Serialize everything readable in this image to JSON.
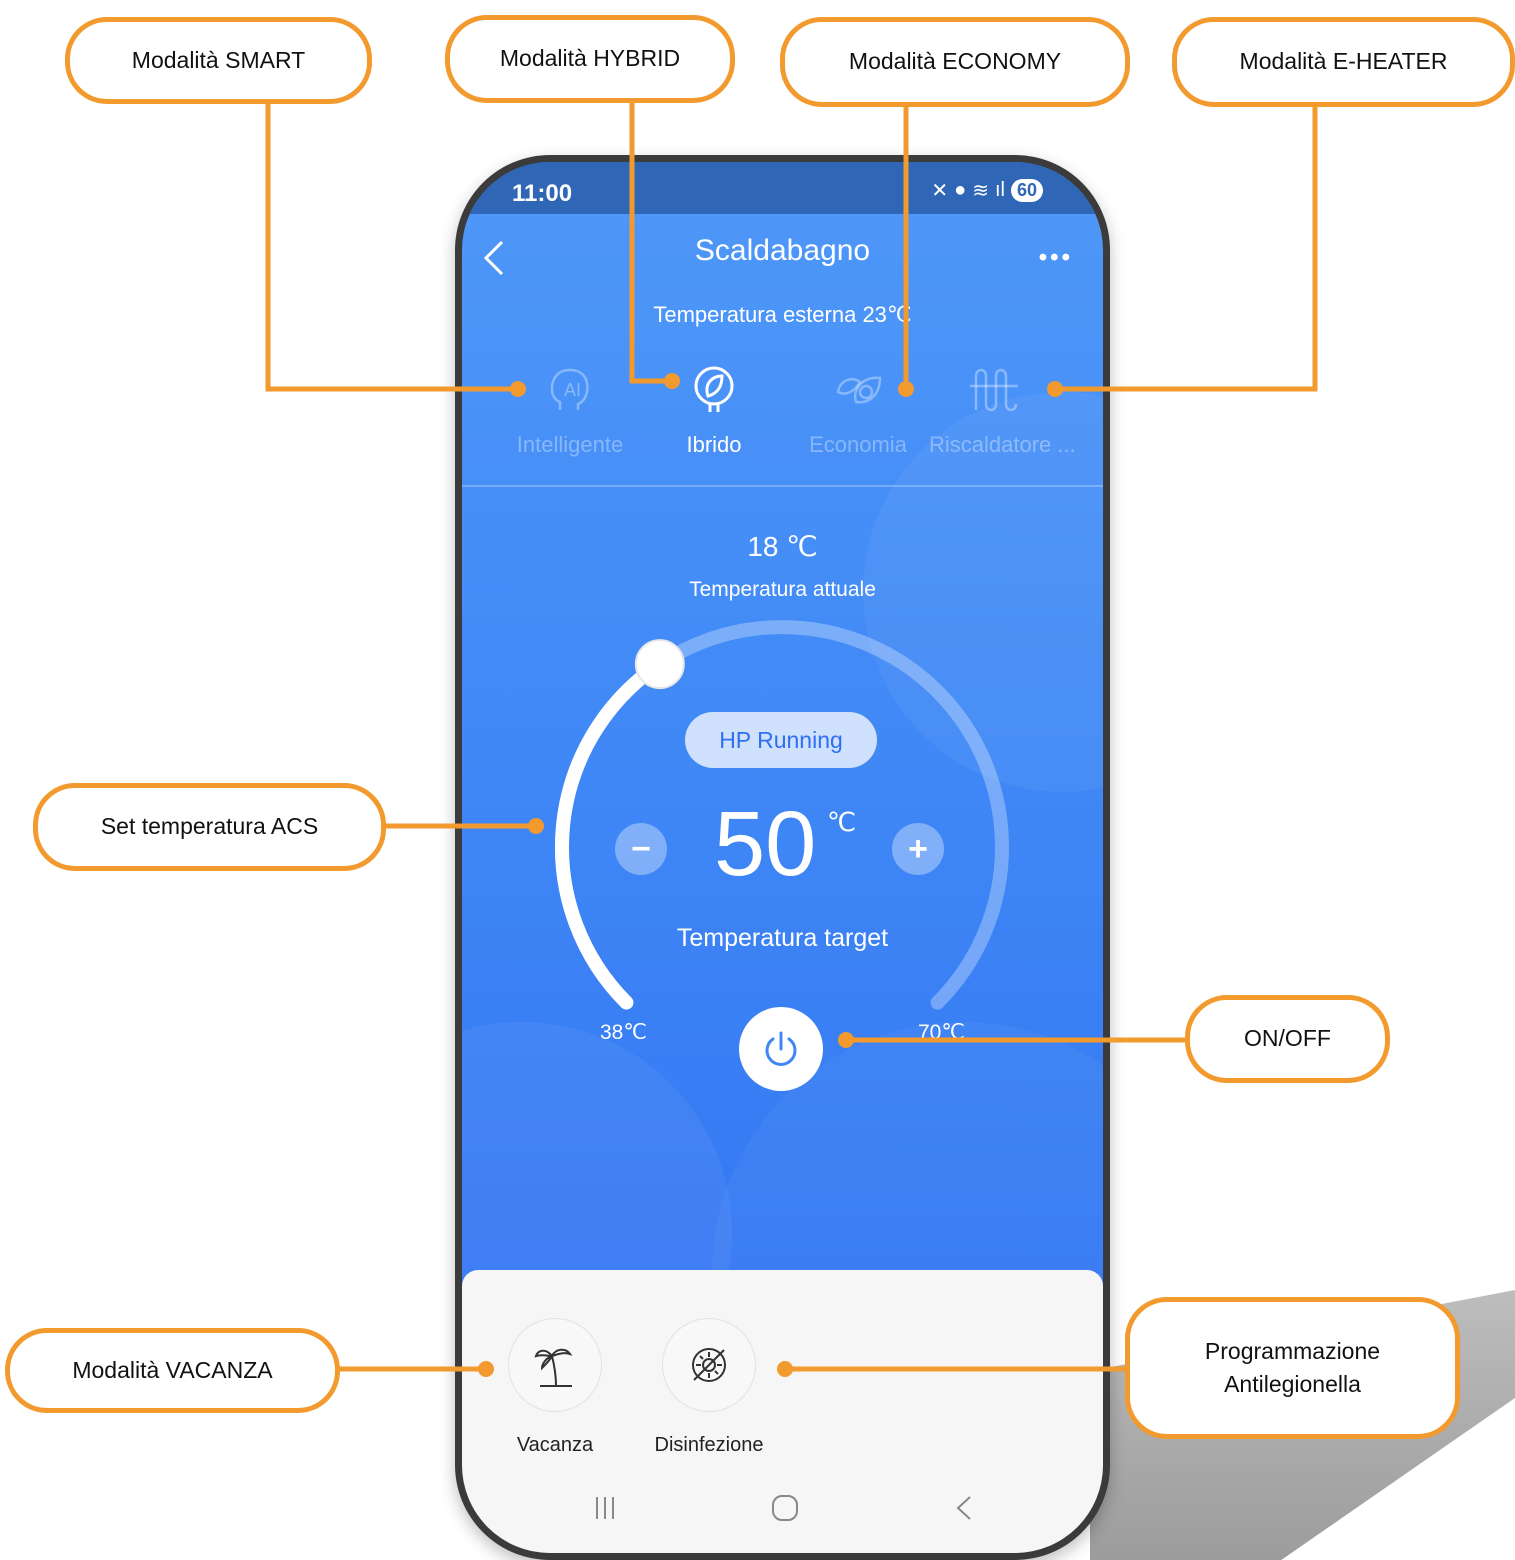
{
  "callouts": {
    "smart": "Modalità SMART",
    "hybrid": "Modalità HYBRID",
    "economy": "Modalità ECONOMY",
    "eheater": "Modalità E-HEATER",
    "set_temp": "Set temperatura ACS",
    "onoff": "ON/OFF",
    "vacanza": "Modalità VACANZA",
    "antilegionella": "Programmazione Antilegionella"
  },
  "status_bar": {
    "time": "11:00",
    "battery": "60"
  },
  "header": {
    "title": "Scaldabagno",
    "external_temp": "Temperatura esterna 23℃"
  },
  "modes": [
    {
      "label": "Intelligente",
      "icon": "ai-head-icon",
      "active": false
    },
    {
      "label": "Ibrido",
      "icon": "hybrid-leaf-plug-icon",
      "active": true
    },
    {
      "label": "Economia",
      "icon": "eco-leaves-icon",
      "active": false
    },
    {
      "label": "Riscaldatore ...",
      "icon": "heater-coil-icon",
      "active": false
    }
  ],
  "current": {
    "value": "18 ℃",
    "label": "Temperatura attuale"
  },
  "dial": {
    "status_badge": "HP Running",
    "target_value": "50",
    "target_unit": "℃",
    "target_label": "Temperatura target",
    "min_label": "38℃",
    "max_label": "70℃",
    "minus_symbol": "−",
    "plus_symbol": "+",
    "min": 38,
    "max": 70,
    "level": 50
  },
  "features": [
    {
      "label": "Vacanza",
      "icon": "palm-tree-icon"
    },
    {
      "label": "Disinfezione",
      "icon": "disinfection-icon"
    }
  ],
  "nav": [
    "recent-apps-icon",
    "home-icon",
    "back-icon"
  ],
  "colors": {
    "accent": "#F29A2E",
    "screen_blue": "#3f87f6",
    "status_bar": "#2f66b6"
  }
}
